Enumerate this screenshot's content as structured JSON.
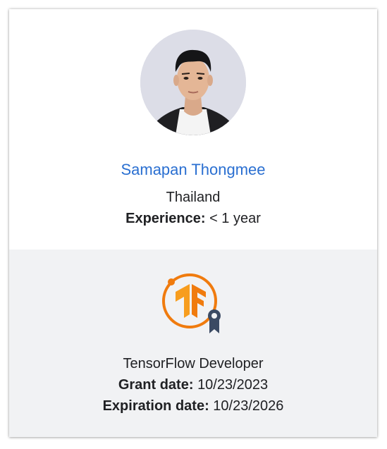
{
  "profile": {
    "name": "Samapan Thongmee",
    "country": "Thailand",
    "experience_label": "Experience:",
    "experience_value": "< 1 year",
    "avatar_icon": "person-photo"
  },
  "certificate": {
    "name": "TensorFlow Developer",
    "grant_label": "Grant date:",
    "grant_value": "10/23/2023",
    "expiration_label": "Expiration date:",
    "expiration_value": "10/23/2026",
    "badge_icon": "tensorflow-certificate-badge-icon"
  },
  "colors": {
    "name_link": "#2a6fd1",
    "badge_orange": "#f07b0e",
    "ribbon_navy": "#3b4a63",
    "cert_background": "#f1f2f4"
  }
}
